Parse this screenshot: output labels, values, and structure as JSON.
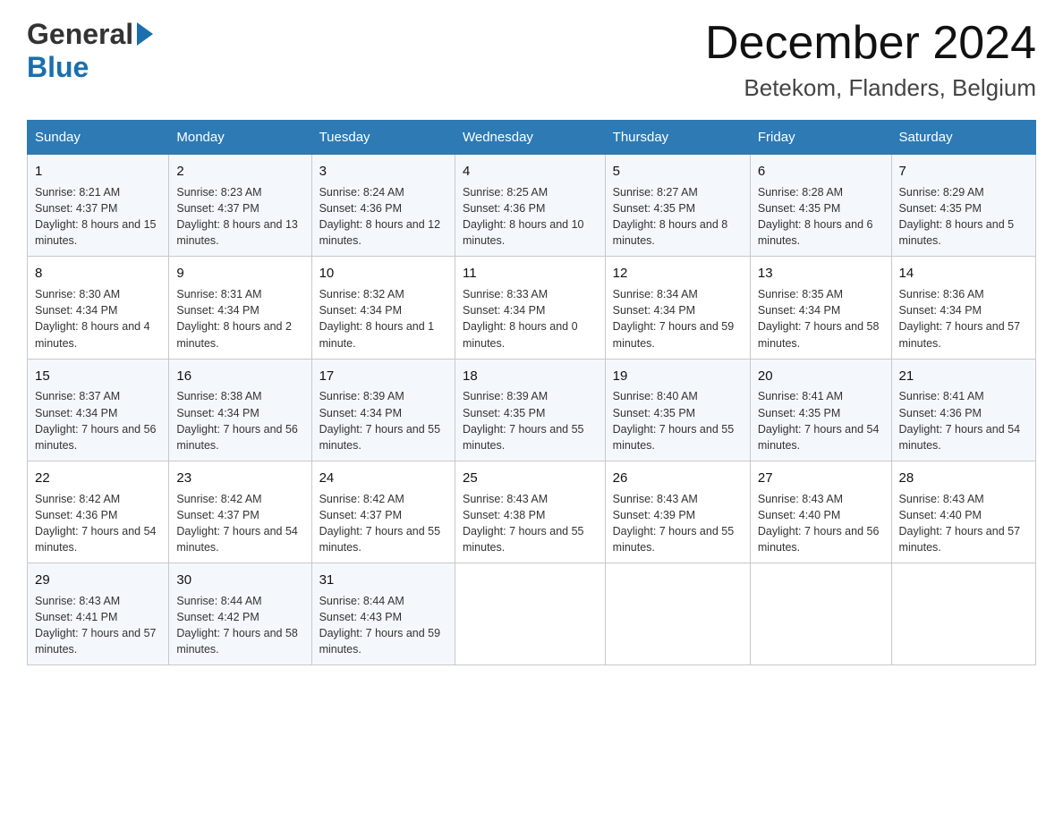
{
  "header": {
    "logo_general": "General",
    "logo_blue": "Blue",
    "month_title": "December 2024",
    "location": "Betekom, Flanders, Belgium"
  },
  "days_of_week": [
    "Sunday",
    "Monday",
    "Tuesday",
    "Wednesday",
    "Thursday",
    "Friday",
    "Saturday"
  ],
  "weeks": [
    [
      {
        "day": "1",
        "sunrise": "Sunrise: 8:21 AM",
        "sunset": "Sunset: 4:37 PM",
        "daylight": "Daylight: 8 hours and 15 minutes."
      },
      {
        "day": "2",
        "sunrise": "Sunrise: 8:23 AM",
        "sunset": "Sunset: 4:37 PM",
        "daylight": "Daylight: 8 hours and 13 minutes."
      },
      {
        "day": "3",
        "sunrise": "Sunrise: 8:24 AM",
        "sunset": "Sunset: 4:36 PM",
        "daylight": "Daylight: 8 hours and 12 minutes."
      },
      {
        "day": "4",
        "sunrise": "Sunrise: 8:25 AM",
        "sunset": "Sunset: 4:36 PM",
        "daylight": "Daylight: 8 hours and 10 minutes."
      },
      {
        "day": "5",
        "sunrise": "Sunrise: 8:27 AM",
        "sunset": "Sunset: 4:35 PM",
        "daylight": "Daylight: 8 hours and 8 minutes."
      },
      {
        "day": "6",
        "sunrise": "Sunrise: 8:28 AM",
        "sunset": "Sunset: 4:35 PM",
        "daylight": "Daylight: 8 hours and 6 minutes."
      },
      {
        "day": "7",
        "sunrise": "Sunrise: 8:29 AM",
        "sunset": "Sunset: 4:35 PM",
        "daylight": "Daylight: 8 hours and 5 minutes."
      }
    ],
    [
      {
        "day": "8",
        "sunrise": "Sunrise: 8:30 AM",
        "sunset": "Sunset: 4:34 PM",
        "daylight": "Daylight: 8 hours and 4 minutes."
      },
      {
        "day": "9",
        "sunrise": "Sunrise: 8:31 AM",
        "sunset": "Sunset: 4:34 PM",
        "daylight": "Daylight: 8 hours and 2 minutes."
      },
      {
        "day": "10",
        "sunrise": "Sunrise: 8:32 AM",
        "sunset": "Sunset: 4:34 PM",
        "daylight": "Daylight: 8 hours and 1 minute."
      },
      {
        "day": "11",
        "sunrise": "Sunrise: 8:33 AM",
        "sunset": "Sunset: 4:34 PM",
        "daylight": "Daylight: 8 hours and 0 minutes."
      },
      {
        "day": "12",
        "sunrise": "Sunrise: 8:34 AM",
        "sunset": "Sunset: 4:34 PM",
        "daylight": "Daylight: 7 hours and 59 minutes."
      },
      {
        "day": "13",
        "sunrise": "Sunrise: 8:35 AM",
        "sunset": "Sunset: 4:34 PM",
        "daylight": "Daylight: 7 hours and 58 minutes."
      },
      {
        "day": "14",
        "sunrise": "Sunrise: 8:36 AM",
        "sunset": "Sunset: 4:34 PM",
        "daylight": "Daylight: 7 hours and 57 minutes."
      }
    ],
    [
      {
        "day": "15",
        "sunrise": "Sunrise: 8:37 AM",
        "sunset": "Sunset: 4:34 PM",
        "daylight": "Daylight: 7 hours and 56 minutes."
      },
      {
        "day": "16",
        "sunrise": "Sunrise: 8:38 AM",
        "sunset": "Sunset: 4:34 PM",
        "daylight": "Daylight: 7 hours and 56 minutes."
      },
      {
        "day": "17",
        "sunrise": "Sunrise: 8:39 AM",
        "sunset": "Sunset: 4:34 PM",
        "daylight": "Daylight: 7 hours and 55 minutes."
      },
      {
        "day": "18",
        "sunrise": "Sunrise: 8:39 AM",
        "sunset": "Sunset: 4:35 PM",
        "daylight": "Daylight: 7 hours and 55 minutes."
      },
      {
        "day": "19",
        "sunrise": "Sunrise: 8:40 AM",
        "sunset": "Sunset: 4:35 PM",
        "daylight": "Daylight: 7 hours and 55 minutes."
      },
      {
        "day": "20",
        "sunrise": "Sunrise: 8:41 AM",
        "sunset": "Sunset: 4:35 PM",
        "daylight": "Daylight: 7 hours and 54 minutes."
      },
      {
        "day": "21",
        "sunrise": "Sunrise: 8:41 AM",
        "sunset": "Sunset: 4:36 PM",
        "daylight": "Daylight: 7 hours and 54 minutes."
      }
    ],
    [
      {
        "day": "22",
        "sunrise": "Sunrise: 8:42 AM",
        "sunset": "Sunset: 4:36 PM",
        "daylight": "Daylight: 7 hours and 54 minutes."
      },
      {
        "day": "23",
        "sunrise": "Sunrise: 8:42 AM",
        "sunset": "Sunset: 4:37 PM",
        "daylight": "Daylight: 7 hours and 54 minutes."
      },
      {
        "day": "24",
        "sunrise": "Sunrise: 8:42 AM",
        "sunset": "Sunset: 4:37 PM",
        "daylight": "Daylight: 7 hours and 55 minutes."
      },
      {
        "day": "25",
        "sunrise": "Sunrise: 8:43 AM",
        "sunset": "Sunset: 4:38 PM",
        "daylight": "Daylight: 7 hours and 55 minutes."
      },
      {
        "day": "26",
        "sunrise": "Sunrise: 8:43 AM",
        "sunset": "Sunset: 4:39 PM",
        "daylight": "Daylight: 7 hours and 55 minutes."
      },
      {
        "day": "27",
        "sunrise": "Sunrise: 8:43 AM",
        "sunset": "Sunset: 4:40 PM",
        "daylight": "Daylight: 7 hours and 56 minutes."
      },
      {
        "day": "28",
        "sunrise": "Sunrise: 8:43 AM",
        "sunset": "Sunset: 4:40 PM",
        "daylight": "Daylight: 7 hours and 57 minutes."
      }
    ],
    [
      {
        "day": "29",
        "sunrise": "Sunrise: 8:43 AM",
        "sunset": "Sunset: 4:41 PM",
        "daylight": "Daylight: 7 hours and 57 minutes."
      },
      {
        "day": "30",
        "sunrise": "Sunrise: 8:44 AM",
        "sunset": "Sunset: 4:42 PM",
        "daylight": "Daylight: 7 hours and 58 minutes."
      },
      {
        "day": "31",
        "sunrise": "Sunrise: 8:44 AM",
        "sunset": "Sunset: 4:43 PM",
        "daylight": "Daylight: 7 hours and 59 minutes."
      },
      null,
      null,
      null,
      null
    ]
  ]
}
